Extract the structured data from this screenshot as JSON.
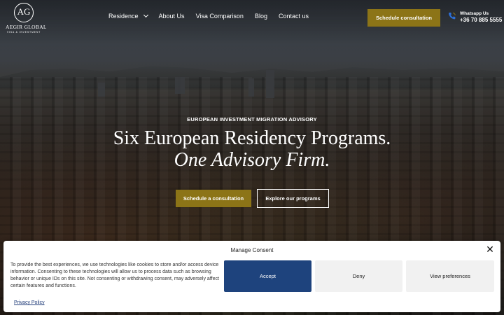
{
  "brand": {
    "monogram": "AG",
    "name": "AEGIR GLOBAL",
    "tagline": "VISA & INVESTMENT"
  },
  "nav": {
    "items": [
      "Residence",
      "About Us",
      "Visa Comparison",
      "Blog",
      "Contact us"
    ]
  },
  "header": {
    "cta_label": "Schedule consultation",
    "whatsapp_label": "Whatsapp Us",
    "whatsapp_phone": "+36 70 885 5555"
  },
  "hero": {
    "eyebrow": "EUROPEAN INVESTMENT MIGRATION ADVISORY",
    "headline_line1": "Six European Residency Programs.",
    "headline_line2": "One Advisory Firm.",
    "primary_button": "Schedule a consultation",
    "secondary_button": "Explore our programs"
  },
  "consent": {
    "title": "Manage Consent",
    "body": "To provide the best experiences, we use technologies like cookies to store and/or access device information. Consenting to these technologies will allow us to process data such as browsing behavior or unique IDs on this site. Not consenting or withdrawing consent, may adversely affect certain features and functions.",
    "accept": "Accept",
    "deny": "Deny",
    "preferences": "View preferences",
    "policy_link": "Privacy Policy"
  },
  "colors": {
    "gold": "#8c7417",
    "accept_blue": "#1e437d"
  },
  "icons": {
    "close": "close-icon",
    "phone": "phone-icon",
    "chevron": "chevron-down-icon"
  }
}
